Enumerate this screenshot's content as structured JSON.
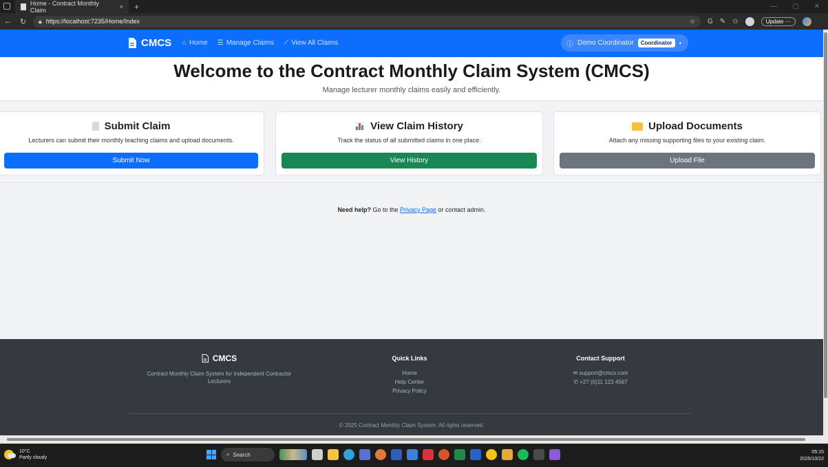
{
  "browser": {
    "tab_title": "Home - Contract Monthly Claim",
    "tab_close": "×",
    "new_tab": "+",
    "url": "https://localhost:7235/Home/Index",
    "update_label": "Update"
  },
  "navbar": {
    "brand": "CMCS",
    "links": [
      "Home",
      "Manage Claims",
      "View All Claims"
    ],
    "user_name": "Demo Coordinator",
    "user_role": "Coordinator"
  },
  "hero": {
    "title": "Welcome to the Contract Monthly Claim System (CMCS)",
    "subtitle": "Manage lecturer monthly claims easily and efficiently."
  },
  "cards": [
    {
      "title": "Submit Claim",
      "text": "Lecturers can submit their monthly teaching claims and upload documents.",
      "button": "Submit Now",
      "color": "#0d6efd"
    },
    {
      "title": "View Claim History",
      "text": "Track the status of all submitted claims in one place.",
      "button": "View History",
      "color": "#198754"
    },
    {
      "title": "Upload Documents",
      "text": "Attach any missing supporting files to your existing claim.",
      "button": "Upload File",
      "color": "#6c757d"
    }
  ],
  "help": {
    "strong": "Need help?",
    "pre": " Go to the ",
    "link": "Privacy Page",
    "post": " or contact admin."
  },
  "footer": {
    "brand": "CMCS",
    "description": "Contract Monthly Claim System for Independent Contractor Lecturers",
    "quick_links_title": "Quick Links",
    "quick_links": [
      "Home",
      "Help Center",
      "Privacy Policy"
    ],
    "contact_title": "Contact Support",
    "email": "support@cmcs.com",
    "phone": "+27 (0)11 123 4567",
    "copyright": "© 2025 Contract Monthly Claim System. All rights reserved."
  },
  "taskbar": {
    "temperature": "10°C",
    "weather": "Partly cloudy",
    "search": "Search",
    "time": "05:15",
    "date": "2025/10/22"
  }
}
